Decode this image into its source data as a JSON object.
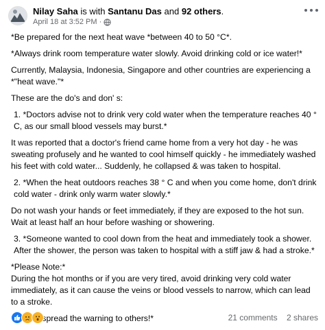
{
  "header": {
    "author": "Nilay Saha",
    "with_text": "is with",
    "tagged": "Santanu Das",
    "and_text": "and",
    "others": "92 others",
    "period": ".",
    "timestamp": "April 18 at 3:52 PM",
    "separator": "·"
  },
  "paragraphs": [
    "*Be prepared for the next heat wave *between 40 to 50 °C*.",
    "*Always drink room temperature water slowly. Avoid drinking cold or ice water!*",
    "Currently, Malaysia, Indonesia, Singapore and other countries are experiencing a *\"heat wave.\"*",
    "These are the do's and don' s:",
    " 1. *Doctors advise not to drink very cold water when the temperature reaches 40 ° C, as our small blood vessels may burst.*",
    "It was reported that a doctor's friend came home from a very hot day - he was sweating profusely and he wanted to cool himself quickly - he immediately washed his feet with cold water... Suddenly, he collapsed & was taken to hospital.",
    " 2. *When the heat outdoors reaches 38 ° C and when you come home,  don't drink cold water - drink only warm water slowly.*",
    "Do not wash your hands or feet immediately, if they are exposed to the hot sun. Wait at least half an hour before washing or showering.",
    " 3. *Someone wanted to cool down from the heat and immediately took a shower. After the shower, the person was taken to hospital with a stiff jaw & had a stroke.*",
    "*Please Note:*\nDuring the hot months or if you are very tired, avoid drinking very cold water immediately, as it can cause the veins or blood vessels to narrow, which can lead to a stroke.",
    "*Please spread the warning to others!*"
  ],
  "footer": {
    "reactions": [
      "like-reaction-icon",
      "sad-reaction-icon",
      "wow-reaction-icon"
    ],
    "comments": "21 comments",
    "shares": "2 shares"
  },
  "colors": {
    "text": "#050505",
    "muted": "#65676b",
    "like": "#1877f2",
    "emoji": "#f7b125"
  }
}
